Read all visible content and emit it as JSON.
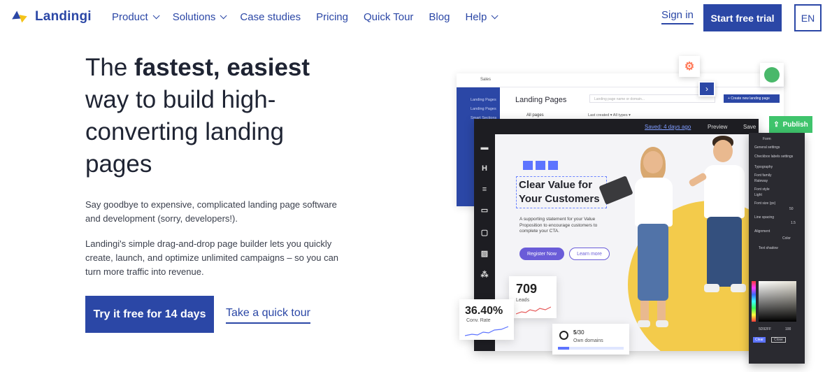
{
  "nav": {
    "logo": "Landingi",
    "items": [
      {
        "label": "Product",
        "dropdown": true
      },
      {
        "label": "Solutions",
        "dropdown": true
      },
      {
        "label": "Case studies",
        "dropdown": false
      },
      {
        "label": "Pricing",
        "dropdown": false
      },
      {
        "label": "Quick Tour",
        "dropdown": false
      },
      {
        "label": "Blog",
        "dropdown": false
      },
      {
        "label": "Help",
        "dropdown": true
      }
    ],
    "signin": "Sign in",
    "trial": "Start free trial",
    "lang": "EN"
  },
  "hero": {
    "line_a": "The ",
    "line_b": "fastest, easiest",
    "line_c": " way to build high-converting landing pages",
    "p1": "Say goodbye to expensive, complicated landing page software and development (sorry, developers!).",
    "p2": "Landingi's simple drag-and-drop page builder lets you quickly create, launch, and optimize unlimited campaigns – so you can turn more traffic into revenue.",
    "cta_primary": "Try it free for 14 days",
    "cta_secondary": "Take a quick tour"
  },
  "mockup": {
    "back": {
      "sales": "Sales",
      "title": "Landing Pages",
      "search_placeholder": "Landing page name or domain...",
      "new_button": "+ Create new landing page",
      "side_items": [
        "Landing Pages",
        "Landing Pages",
        "Smart Sections"
      ],
      "all_pages": "All pages",
      "filters": "Last created ▾    All types ▾"
    },
    "front": {
      "saved": "Saved: 4 days ago",
      "preview": "Preview",
      "save": "Save",
      "publish": "Publish",
      "canvas_title": "Clear Value for Your Customers",
      "canvas_desc": "A supporting statement for your Value Proposition to encourage customers to complete your CTA.",
      "register": "Register Now",
      "learn": "Learn more"
    },
    "panel": {
      "form": "Form",
      "general": "General settings",
      "checkbox": "Checkbox labels settings",
      "typography": "Typography",
      "font_family": "Font family",
      "font_family_val": "Raleway",
      "font_style": "Font style",
      "font_style_val": "Light",
      "font_size": "Font size (px)",
      "font_size_val": "50",
      "line_spacing": "Line spacing",
      "line_spacing_val": "1.5",
      "alignment": "Alignment",
      "color": "Color",
      "text_shadow": "Text shadow",
      "hex": "5D92FF",
      "opacity": "100",
      "clear": "Clear",
      "close": "Close"
    },
    "stats": {
      "leads_value": "709",
      "leads_label": "Leads",
      "conv_value": "36.40%",
      "conv_label": "Conv. Rate",
      "domains_used": "5",
      "domains_total": "/30",
      "domains_label": "Own domains",
      "domains_progress": 0.17
    }
  },
  "colors": {
    "brand": "#2b47a6",
    "accent_yellow": "#f4c319",
    "publish_green": "#3fc46c",
    "canvas_purple": "#6a5cd8"
  }
}
